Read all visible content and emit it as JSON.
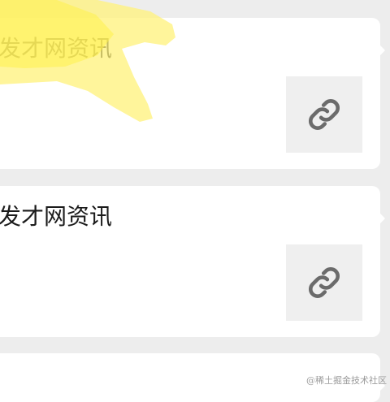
{
  "feed": {
    "items": [
      {
        "title": "发才网资讯",
        "icon": "link-icon"
      },
      {
        "title": "发才网资讯",
        "icon": "link-icon"
      }
    ]
  },
  "watermark": "@稀土掘金技术社区",
  "colors": {
    "background": "#ededed",
    "card": "#ffffff",
    "icon_box": "#efefef",
    "icon": "#6b6b6b",
    "highlight": "#fff176"
  }
}
